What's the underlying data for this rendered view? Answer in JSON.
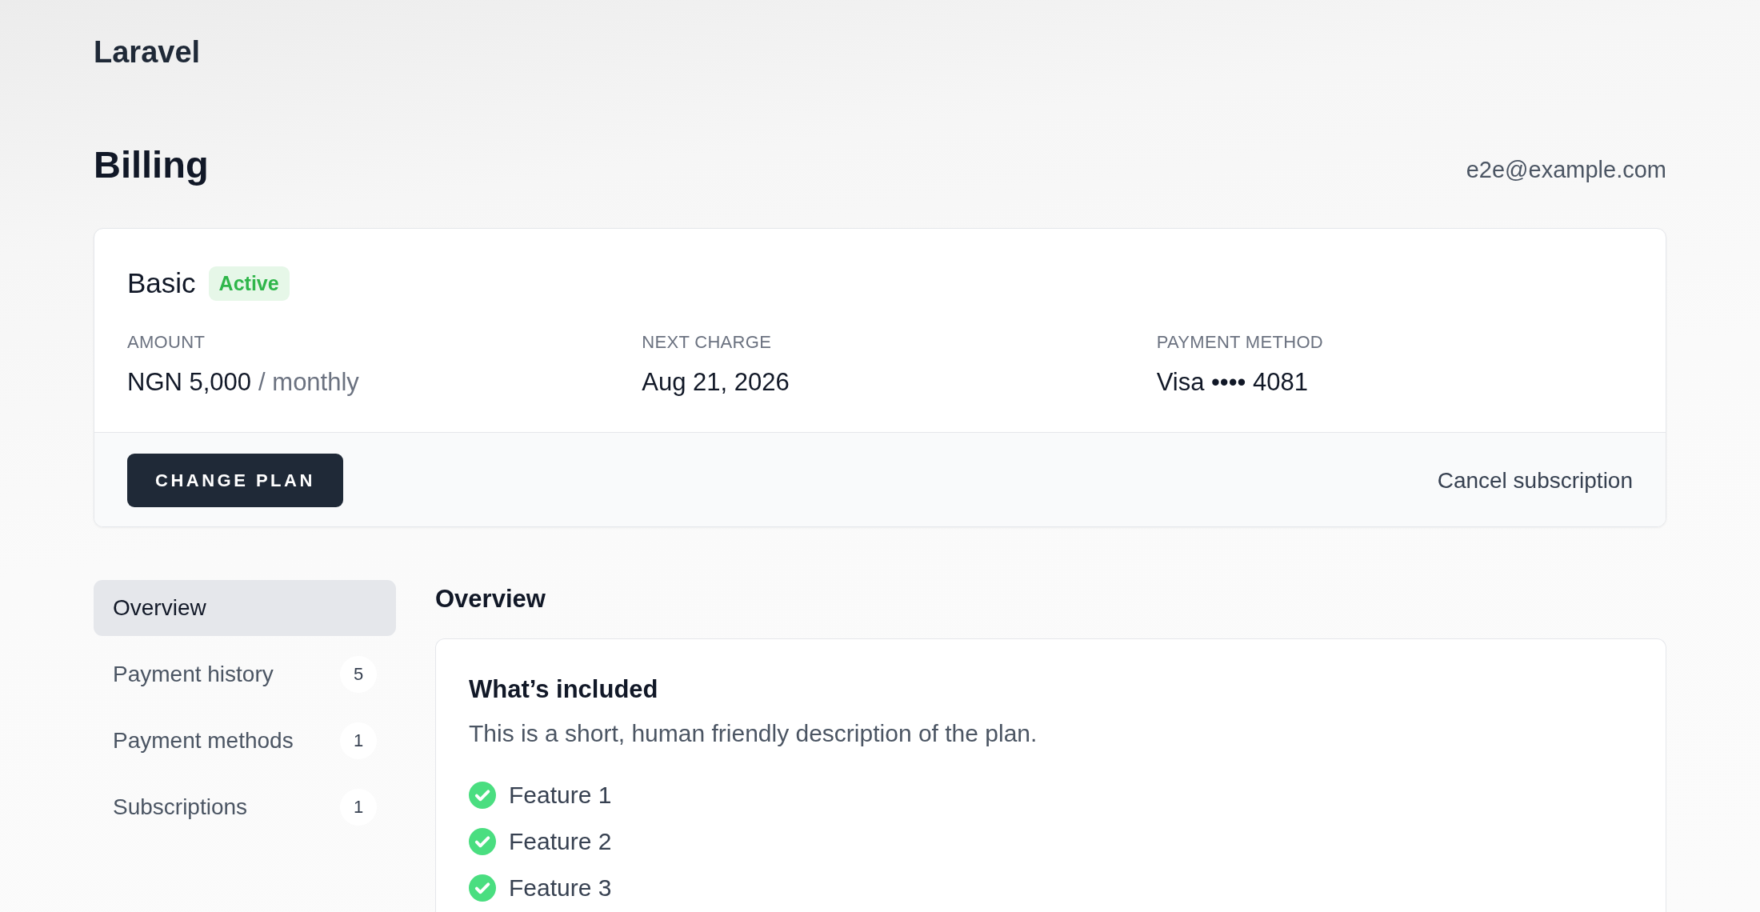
{
  "app": {
    "name": "Laravel"
  },
  "header": {
    "title": "Billing",
    "email": "e2e@example.com"
  },
  "subscription": {
    "plan": "Basic",
    "status": "Active",
    "details": [
      {
        "label": "AMOUNT",
        "value": "NGN 5,000",
        "suffix": "/ monthly"
      },
      {
        "label": "NEXT CHARGE",
        "value": "Aug 21, 2026"
      },
      {
        "label": "PAYMENT METHOD",
        "value": "Visa •••• 4081"
      }
    ],
    "primary_action": "CHANGE PLAN",
    "secondary_action": "Cancel subscription"
  },
  "sidebar": {
    "items": [
      {
        "label": "Overview",
        "selected": true
      },
      {
        "label": "Payment history",
        "count": "5",
        "selected": false
      },
      {
        "label": "Payment methods",
        "count": "1",
        "selected": false
      },
      {
        "label": "Subscriptions",
        "count": "1",
        "selected": false
      }
    ]
  },
  "overview": {
    "title": "Overview",
    "card": {
      "title": "What’s included",
      "description": "This is a short, human friendly description of the plan.",
      "features": [
        {
          "label": "Feature 1"
        },
        {
          "label": "Feature 2"
        },
        {
          "label": "Feature 3"
        }
      ]
    }
  }
}
